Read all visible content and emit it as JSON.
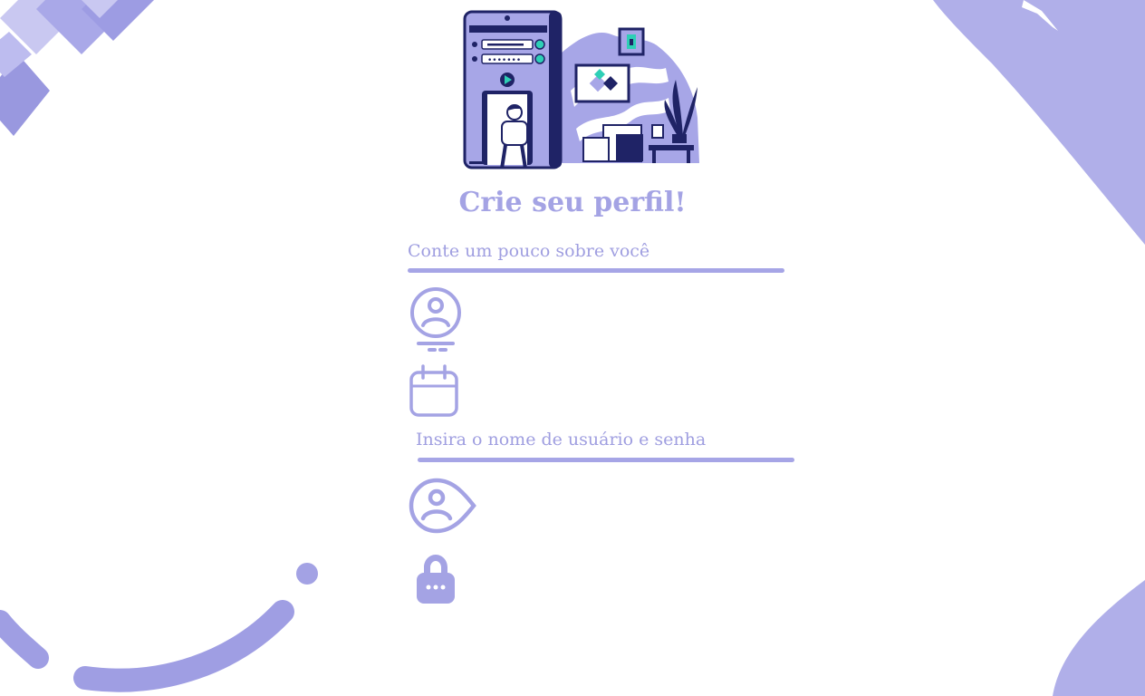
{
  "page": {
    "title": "Crie seu perfil!"
  },
  "sections": {
    "about": {
      "label": "Conte um pouco sobre você"
    },
    "credentials": {
      "label": "Insira o nome de usuário e senha"
    }
  },
  "fields": {
    "name": {
      "icon": "user-circle-icon"
    },
    "birthdate": {
      "icon": "calendar-icon"
    },
    "username": {
      "icon": "user-eye-icon"
    },
    "password": {
      "icon": "padlock-icon"
    }
  },
  "theme": {
    "accent": "#a4a3e4",
    "accent_dark": "#1f2366",
    "accent_teal": "#2ecfb6",
    "background": "#ffffff"
  }
}
